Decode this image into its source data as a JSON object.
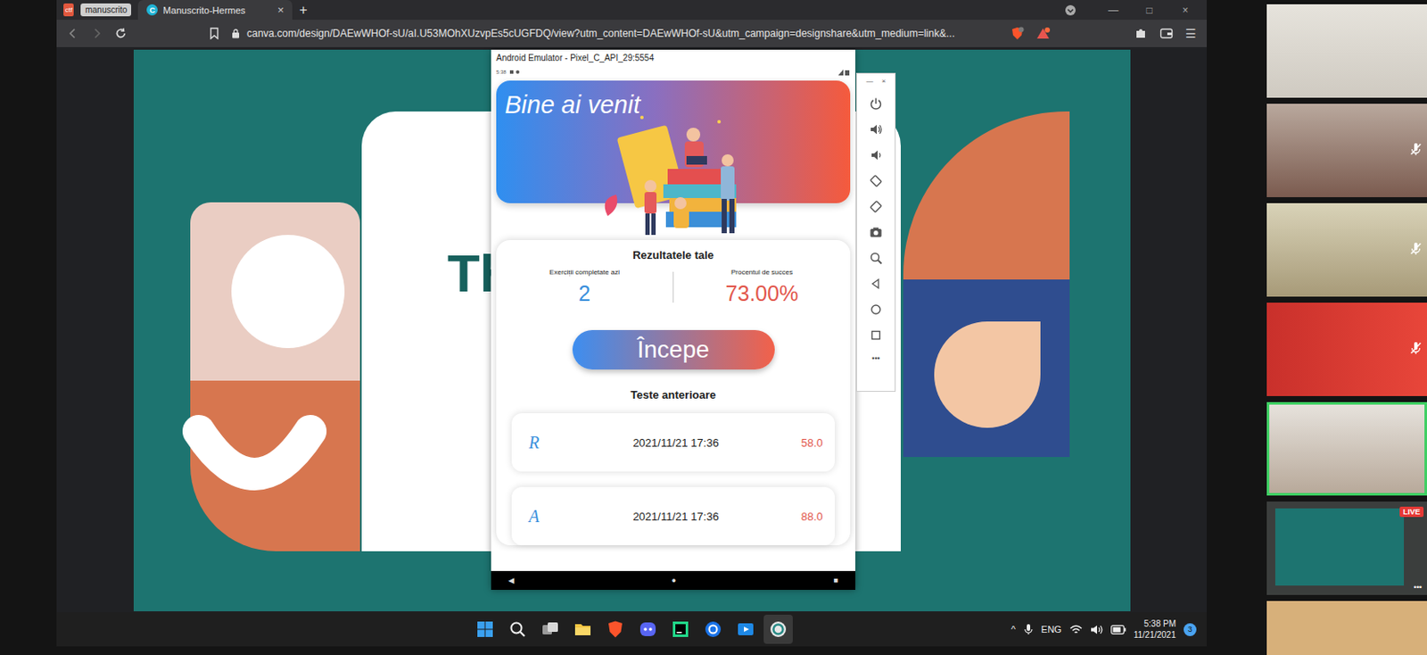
{
  "browser": {
    "tabs": [
      {
        "label": "ctf",
        "kind": "favicon",
        "selected": false
      },
      {
        "label": "manuscrito",
        "kind": "group",
        "selected": false
      },
      {
        "label": "Manuscrito-Hermes",
        "kind": "page",
        "selected": true,
        "favicon": "C",
        "close": "×"
      }
    ],
    "new_tab": "+",
    "url": "canva.com/design/DAEwWHOf-sU/aI.U53MOhXUzvpEs5cUGFDQ/view?utm_content=DAEwWHOf-sU&utm_campaign=designshare&utm_medium=link&...",
    "window_controls": [
      "—",
      "□",
      "×"
    ],
    "menu": "☰"
  },
  "slide": {
    "title": "Th"
  },
  "emulator": {
    "title": "Android Emulator - Pixel_C_API_29:5554",
    "status_time": "5:38",
    "controls": [
      "—",
      "×"
    ],
    "app": {
      "banner": "Bine ai venit",
      "results_title": "Rezultatele tale",
      "stats": [
        {
          "label": "Exerciții completate azi",
          "value": "2",
          "color": "#3a8fdc"
        },
        {
          "label": "Procentul de succes",
          "value": "73.00%",
          "color": "#e2574c"
        }
      ],
      "start_button": "Începe",
      "history_title": "Teste anterioare",
      "history": [
        {
          "letter": "R",
          "date": "2021/11/21 17:36",
          "score": "58.0"
        },
        {
          "letter": "A",
          "date": "2021/11/21 17:36",
          "score": "88.0"
        }
      ]
    },
    "nav": [
      "◀",
      "●",
      "■"
    ],
    "toolbar_more": "•••"
  },
  "participants": [
    {
      "muted": false,
      "speaking": false
    },
    {
      "muted": true,
      "speaking": false
    },
    {
      "muted": true,
      "speaking": false
    },
    {
      "muted": true,
      "speaking": false
    },
    {
      "muted": false,
      "speaking": true
    },
    {
      "muted": false,
      "speaking": false,
      "badge": "LIVE",
      "more": "•••"
    },
    {
      "muted": false,
      "speaking": false
    }
  ],
  "taskbar": {
    "apps": [
      {
        "kind": "windows",
        "active": false
      },
      {
        "kind": "search",
        "active": false
      },
      {
        "kind": "taskview",
        "active": false
      },
      {
        "kind": "files",
        "active": false
      },
      {
        "kind": "brave",
        "active": false
      },
      {
        "kind": "discord",
        "active": false
      },
      {
        "kind": "pycharm",
        "active": false
      },
      {
        "kind": "zoom",
        "active": false
      },
      {
        "kind": "media",
        "active": false
      },
      {
        "kind": "app",
        "active": true
      }
    ],
    "tray": {
      "chevron": "^",
      "language": "ENG",
      "time": "5:38 PM",
      "date": "11/21/2021",
      "notifications": "3"
    }
  }
}
